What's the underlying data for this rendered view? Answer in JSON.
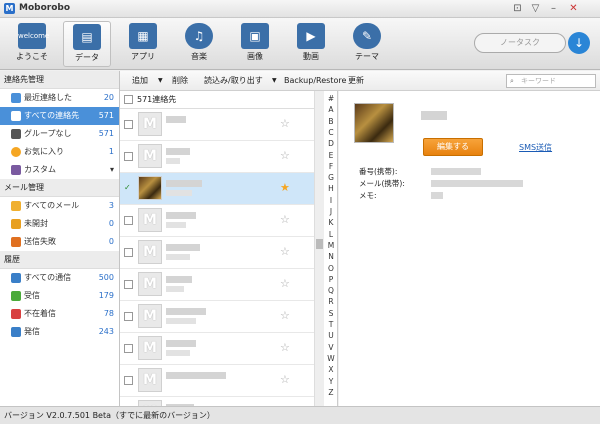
{
  "window": {
    "title": "Moborobo",
    "logo_text": "M",
    "controls": [
      "⊡",
      "▽",
      "–",
      "✕"
    ]
  },
  "toolbar": {
    "tools": [
      {
        "label": "ようこそ",
        "icon": "welcome-icon",
        "glyph": "welcome"
      },
      {
        "label": "データ",
        "icon": "data-icon",
        "glyph": "▤"
      },
      {
        "label": "アプリ",
        "icon": "apps-icon",
        "glyph": "▦"
      },
      {
        "label": "音楽",
        "icon": "music-icon",
        "glyph": "♫"
      },
      {
        "label": "画像",
        "icon": "image-icon",
        "glyph": "▣"
      },
      {
        "label": "動画",
        "icon": "video-icon",
        "glyph": "▶"
      },
      {
        "label": "テーマ",
        "icon": "theme-icon",
        "glyph": "✎"
      }
    ],
    "search_placeholder": "ノータスク",
    "download_glyph": "↓"
  },
  "sidebar": {
    "contacts_header": "連絡先管理",
    "contacts": [
      {
        "label": "最近連絡した",
        "count": "20",
        "color": "#4a90d9"
      },
      {
        "label": "すべての連絡先",
        "count": "571",
        "color": "#2a6fc9"
      },
      {
        "label": "グループなし",
        "count": "571",
        "color": "#555555"
      },
      {
        "label": "お気に入り",
        "count": "1",
        "color": "#f5a623"
      },
      {
        "label": "カスタム",
        "count": "▾",
        "color": "#7a5aa0"
      }
    ],
    "mail_header": "メール管理",
    "mail": [
      {
        "label": "すべてのメール",
        "count": "3",
        "color": "#f0b030"
      },
      {
        "label": "未開封",
        "count": "0",
        "color": "#e8a020"
      },
      {
        "label": "送信失敗",
        "count": "0",
        "color": "#e07020"
      }
    ],
    "history_header": "履歴",
    "history": [
      {
        "label": "すべての通信",
        "count": "500",
        "color": "#3a7fc8"
      },
      {
        "label": "受信",
        "count": "179",
        "color": "#4aaa3a"
      },
      {
        "label": "不在着信",
        "count": "78",
        "color": "#d84040"
      },
      {
        "label": "発信",
        "count": "243",
        "color": "#3a7fc8"
      }
    ]
  },
  "actions": {
    "add": "追加",
    "delete": "削除",
    "import_export": "読込み/取り出す",
    "backup": "Backup/Restore",
    "refresh": "更新",
    "filter_placeholder": "キーワード"
  },
  "list": {
    "header": "571連絡先",
    "rows": [
      {
        "selected": false,
        "photo": false,
        "starred": false,
        "w1": 20,
        "w2": 0
      },
      {
        "selected": false,
        "photo": false,
        "starred": false,
        "w1": 24,
        "w2": 14
      },
      {
        "selected": true,
        "photo": true,
        "starred": true,
        "w1": 36,
        "w2": 26
      },
      {
        "selected": false,
        "photo": false,
        "starred": false,
        "w1": 30,
        "w2": 20
      },
      {
        "selected": false,
        "photo": false,
        "starred": false,
        "w1": 34,
        "w2": 24
      },
      {
        "selected": false,
        "photo": false,
        "starred": false,
        "w1": 26,
        "w2": 18
      },
      {
        "selected": false,
        "photo": false,
        "starred": false,
        "w1": 40,
        "w2": 30
      },
      {
        "selected": false,
        "photo": false,
        "starred": false,
        "w1": 30,
        "w2": 24
      },
      {
        "selected": false,
        "photo": false,
        "starred": false,
        "w1": 60,
        "w2": 0
      },
      {
        "selected": false,
        "photo": false,
        "starred": false,
        "w1": 28,
        "w2": 20
      }
    ]
  },
  "alphabet": [
    "#",
    "A",
    "B",
    "C",
    "D",
    "E",
    "F",
    "G",
    "H",
    "I",
    "J",
    "K",
    "L",
    "M",
    "N",
    "O",
    "P",
    "Q",
    "R",
    "S",
    "T",
    "U",
    "V",
    "W",
    "X",
    "Y",
    "Z"
  ],
  "detail": {
    "edit_label": "編集する",
    "sms_label": "SMS送信",
    "fields": [
      {
        "label": "番号(携帯):",
        "w": 50
      },
      {
        "label": "メール(携帯):",
        "w": 92
      },
      {
        "label": "メモ:",
        "w": 12
      }
    ]
  },
  "status": {
    "text": "バージョン V2.0.7.501 Beta（すでに最新のバージョン）"
  },
  "colors": {
    "accent": "#4a90d9",
    "orange": "#e8820f",
    "star": "#f5a623"
  }
}
